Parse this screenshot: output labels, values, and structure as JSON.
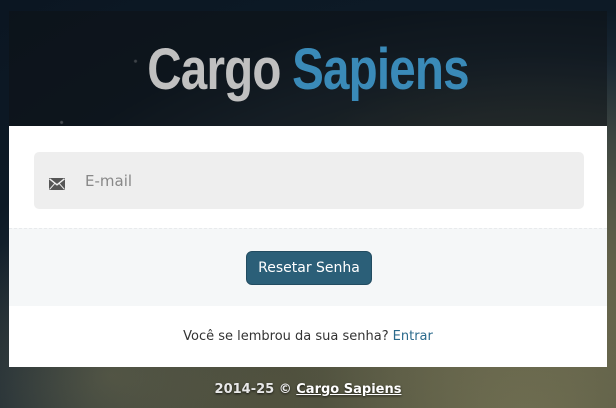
{
  "brand": {
    "part1": "Cargo",
    "part2": "Sapiens"
  },
  "form": {
    "email_placeholder": "E-mail",
    "email_value": "",
    "email_icon": "envelope-icon",
    "submit_label": "Resetar Senha"
  },
  "footer": {
    "remember_text": "Você se lembrou da sua senha?",
    "login_link": "Entrar"
  },
  "page_footer": {
    "copyright": "2014-25 ©",
    "brand_link": "Cargo Sapiens"
  },
  "colors": {
    "brand_gray": "#c0c0c0",
    "brand_blue": "#3a8ab8",
    "button_bg": "#2b5f78",
    "link": "#2b6a8c"
  }
}
